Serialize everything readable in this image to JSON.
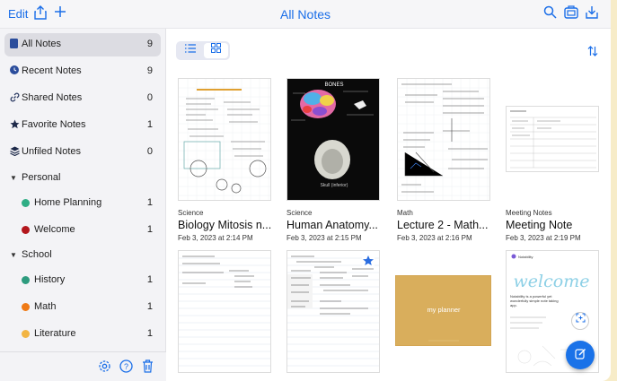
{
  "topbar": {
    "edit_label": "Edit",
    "title": "All Notes",
    "left_icons": [
      "share-icon",
      "add-icon"
    ],
    "right_icons": [
      "search-icon",
      "import-icon",
      "download-icon"
    ]
  },
  "sidebar": {
    "items": [
      {
        "label": "All Notes",
        "count": "9",
        "icon": "notes-icon",
        "active": true
      },
      {
        "label": "Recent Notes",
        "count": "9",
        "icon": "clock-icon"
      },
      {
        "label": "Shared Notes",
        "count": "0",
        "icon": "link-icon"
      },
      {
        "label": "Favorite Notes",
        "count": "1",
        "icon": "star-icon"
      },
      {
        "label": "Unfiled Notes",
        "count": "0",
        "icon": "stack-icon"
      }
    ],
    "sections": [
      {
        "label": "Personal",
        "subjects": [
          {
            "label": "Home Planning",
            "count": "1",
            "color": "#2fae85"
          },
          {
            "label": "Welcome",
            "count": "1",
            "color": "#b3161c"
          }
        ]
      },
      {
        "label": "School",
        "subjects": [
          {
            "label": "History",
            "count": "1",
            "color": "#2d9b7e"
          },
          {
            "label": "Math",
            "count": "1",
            "color": "#ef7a16"
          },
          {
            "label": "Literature",
            "count": "1",
            "color": "#f2b544"
          }
        ]
      }
    ],
    "footer_icons": [
      "settings-icon",
      "help-icon",
      "trash-icon"
    ]
  },
  "notes": [
    {
      "category": "Science",
      "title": "Biology Mitosis n...",
      "date": "Feb 3, 2023 at 2:14 PM"
    },
    {
      "category": "Science",
      "title": "Human Anatomy...",
      "date": "Feb 3, 2023 at 2:15 PM"
    },
    {
      "category": "Math",
      "title": "Lecture 2 - Math...",
      "date": "Feb 3, 2023 at 2:16 PM"
    },
    {
      "category": "Meeting Notes",
      "title": "Meeting Note",
      "date": "Feb 3, 2023 at 2:19 PM"
    }
  ],
  "thumb_text": {
    "bones": "BONES",
    "skull": "Skull (inferior)",
    "planner": "my planner",
    "welcome": "welcome",
    "notability": "Notability",
    "welcome_sub": "Notability is a powerful yet wonderfully simple note taking app."
  },
  "colors": {
    "accent": "#1a6ee8",
    "background": "#f7ecc8"
  }
}
